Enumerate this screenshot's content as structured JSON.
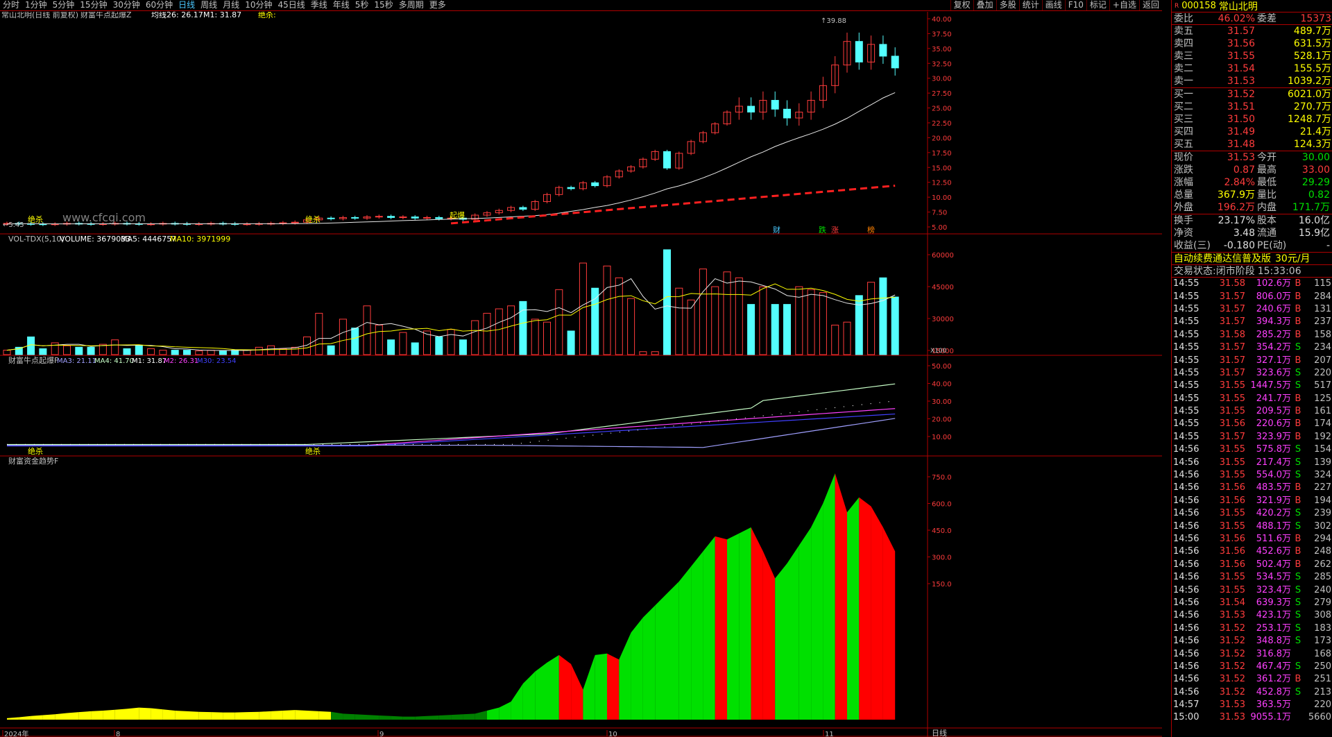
{
  "toolbar": {
    "tabs": [
      "分时",
      "1分钟",
      "5分钟",
      "15分钟",
      "30分钟",
      "60分钟",
      "日线",
      "周线",
      "月线",
      "10分钟",
      "45日线",
      "季线",
      "年线",
      "5秒",
      "15秒",
      "多周期",
      "更多"
    ],
    "active": "日线",
    "right": [
      "复权",
      "叠加",
      "多股",
      "统计",
      "画线",
      "F10",
      "标记",
      "+自选",
      "返回"
    ]
  },
  "main_panel": {
    "title": "常山北明(日线 前复权)",
    "indicator": "财富牛点起爆Z",
    "ma_label": "均线26: 26.17",
    "m1_label": "M1: 31.87",
    "sig": "绝杀:",
    "y_ticks": [
      "40.00",
      "37.50",
      "35.00",
      "32.50",
      "30.00",
      "27.50",
      "25.00",
      "22.50",
      "20.00",
      "17.50",
      "15.00",
      "12.50",
      "10.00",
      "7.50",
      "5.00"
    ],
    "watermark": "www.cfcgi.com",
    "low_label": "5.45",
    "high_label": "39.88",
    "tags": [
      "财",
      "跌",
      "涨",
      "榜"
    ],
    "markers": [
      "绝杀",
      "绝杀",
      "起爆"
    ]
  },
  "vol_panel": {
    "title": "VOL-TDX(5,10)",
    "volume": "VOLUME: 3679033",
    "ma5": "MA5: 4446757",
    "ma10": "MA10: 3971999",
    "y_ticks": [
      "60000",
      "45000",
      "30000",
      "15000"
    ],
    "unit": "X100"
  },
  "ind_panel": {
    "title": "财富牛点起爆F",
    "ma3": "MA3: 21.11",
    "ma4": "MA4: 41.70",
    "m1": "M1: 31.87",
    "m2": "M2: 26.31",
    "m30": "M30: 23.54",
    "y_ticks": [
      "50.00",
      "40.00",
      "30.00",
      "20.00",
      "10.00"
    ],
    "markers": [
      "绝杀",
      "绝杀"
    ]
  },
  "fund_panel": {
    "title": "财富资金趋势F",
    "y_ticks": [
      "750.0",
      "600.0",
      "450.0",
      "300.0",
      "150.0"
    ]
  },
  "x_axis": {
    "labels": [
      "2024年",
      "8",
      "9",
      "10",
      "11"
    ],
    "period": "日线"
  },
  "quote": {
    "code": "000158",
    "name": "常山北明",
    "ratio": {
      "label": "委比",
      "value": "46.02%",
      "label2": "委差",
      "value2": "15373"
    },
    "sells": [
      {
        "label": "卖五",
        "price": "31.57",
        "vol": "489.7万"
      },
      {
        "label": "卖四",
        "price": "31.56",
        "vol": "631.5万"
      },
      {
        "label": "卖三",
        "price": "31.55",
        "vol": "528.1万"
      },
      {
        "label": "卖二",
        "price": "31.54",
        "vol": "155.5万"
      },
      {
        "label": "卖一",
        "price": "31.53",
        "vol": "1039.2万"
      }
    ],
    "buys": [
      {
        "label": "买一",
        "price": "31.52",
        "vol": "6021.0万"
      },
      {
        "label": "买二",
        "price": "31.51",
        "vol": "270.7万"
      },
      {
        "label": "买三",
        "price": "31.50",
        "vol": "1248.7万"
      },
      {
        "label": "买四",
        "price": "31.49",
        "vol": "21.4万"
      },
      {
        "label": "买五",
        "price": "31.48",
        "vol": "124.3万"
      }
    ],
    "stats": [
      [
        "现价",
        "31.53",
        "今开",
        "30.00"
      ],
      [
        "涨跌",
        "0.87",
        "最高",
        "33.00"
      ],
      [
        "涨幅",
        "2.84%",
        "最低",
        "29.29"
      ],
      [
        "总量",
        "367.9万",
        "量比",
        "0.82"
      ],
      [
        "外盘",
        "196.2万",
        "内盘",
        "171.7万"
      ]
    ],
    "stats2": [
      [
        "换手",
        "23.17%",
        "股本",
        "16.0亿"
      ],
      [
        "净资",
        "3.48",
        "流通",
        "15.9亿"
      ],
      [
        "收益(三)",
        "-0.180",
        "PE(动)",
        "-"
      ]
    ],
    "promo": "自动续费通达信普及版",
    "promo_price": "30元/月",
    "trade_status_label": "交易状态:",
    "trade_status": "闭市阶段",
    "trade_time": "15:33:06",
    "ticks": [
      [
        "14:55",
        "31.58",
        "102.6万",
        "B",
        "115"
      ],
      [
        "14:55",
        "31.57",
        "806.0万",
        "B",
        "284"
      ],
      [
        "14:55",
        "31.57",
        "240.6万",
        "B",
        "131"
      ],
      [
        "14:55",
        "31.57",
        "394.3万",
        "B",
        "237"
      ],
      [
        "14:55",
        "31.58",
        "285.2万",
        "B",
        "158"
      ],
      [
        "14:55",
        "31.57",
        "354.2万",
        "S",
        "234"
      ],
      [
        "14:55",
        "31.57",
        "327.1万",
        "B",
        "207"
      ],
      [
        "14:55",
        "31.57",
        "323.6万",
        "S",
        "220"
      ],
      [
        "14:55",
        "31.55",
        "1447.5万",
        "S",
        "517"
      ],
      [
        "14:55",
        "31.55",
        "241.7万",
        "B",
        "125"
      ],
      [
        "14:55",
        "31.55",
        "209.5万",
        "B",
        "161"
      ],
      [
        "14:55",
        "31.56",
        "220.6万",
        "B",
        "174"
      ],
      [
        "14:55",
        "31.57",
        "323.9万",
        "B",
        "192"
      ],
      [
        "14:56",
        "31.55",
        "575.8万",
        "S",
        "154"
      ],
      [
        "14:56",
        "31.55",
        "217.4万",
        "S",
        "139"
      ],
      [
        "14:56",
        "31.55",
        "554.0万",
        "S",
        "324"
      ],
      [
        "14:56",
        "31.56",
        "483.5万",
        "B",
        "227"
      ],
      [
        "14:56",
        "31.56",
        "321.9万",
        "B",
        "194"
      ],
      [
        "14:56",
        "31.55",
        "420.2万",
        "S",
        "239"
      ],
      [
        "14:56",
        "31.55",
        "488.1万",
        "S",
        "302"
      ],
      [
        "14:56",
        "31.56",
        "511.6万",
        "B",
        "294"
      ],
      [
        "14:56",
        "31.56",
        "452.6万",
        "B",
        "248"
      ],
      [
        "14:56",
        "31.56",
        "502.4万",
        "B",
        "262"
      ],
      [
        "14:56",
        "31.55",
        "534.5万",
        "S",
        "285"
      ],
      [
        "14:56",
        "31.55",
        "323.4万",
        "S",
        "240"
      ],
      [
        "14:56",
        "31.54",
        "639.3万",
        "S",
        "279"
      ],
      [
        "14:56",
        "31.53",
        "423.1万",
        "S",
        "308"
      ],
      [
        "14:56",
        "31.52",
        "253.1万",
        "S",
        "183"
      ],
      [
        "14:56",
        "31.52",
        "348.8万",
        "S",
        "173"
      ],
      [
        "14:56",
        "31.52",
        "316.8万",
        "",
        "168"
      ],
      [
        "14:56",
        "31.52",
        "467.4万",
        "S",
        "250"
      ],
      [
        "14:56",
        "31.52",
        "361.2万",
        "B",
        "251"
      ],
      [
        "14:56",
        "31.52",
        "452.8万",
        "S",
        "213"
      ],
      [
        "14:57",
        "31.53",
        "363.5万",
        "",
        "220"
      ],
      [
        "15:00",
        "31.53",
        "9055.1万",
        "",
        "5660"
      ]
    ]
  },
  "colors": {
    "up": "#ff3c3c",
    "down": "#54ffff",
    "grid": "#b00000",
    "ma": "#e8e8e8",
    "yellow": "#ffff00",
    "fund_up": "#ff0000",
    "fund_dn": "#00e000"
  }
}
